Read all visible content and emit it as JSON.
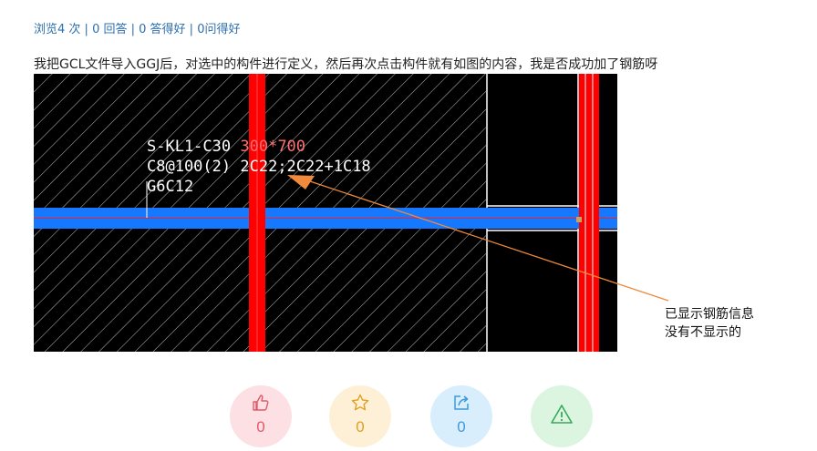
{
  "stats": {
    "views": "浏览4 次",
    "answers": "0 回答",
    "good_answers": "0 答得好",
    "good_questions": "0问得好",
    "separator": " | "
  },
  "question": {
    "text": "我把GCL文件导入GGJ后，对选中的构件进行定义，然后再次点击构件就有如图的内容，我是否成功加了钢筋呀"
  },
  "cad": {
    "line1": "S-KL1-C30",
    "line1_red": "300*700",
    "line2_a": "C8@100(2)",
    "line2_b": "2C22;2C22+1C18",
    "line3": "G6C12",
    "colors": {
      "background": "#000000",
      "hatch": "#c8c8c8",
      "beam": "#1677ff",
      "column": "#ff0000",
      "text": "#ffffff"
    }
  },
  "annotation": {
    "line1": "已显示钢筋信息",
    "line2": "没有不显示的"
  },
  "actions": {
    "like_count": "0",
    "favorite_count": "0",
    "share_count": "0",
    "colors": {
      "like": "#e05a6a",
      "favorite": "#e0a020",
      "share": "#3e9ad8",
      "report": "#3aa85a"
    }
  }
}
